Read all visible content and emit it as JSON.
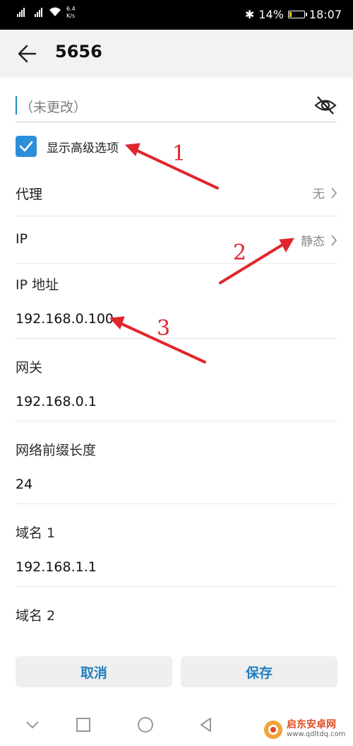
{
  "status_bar": {
    "signal1": "4G",
    "signal2": "x",
    "net_speed_value": "6.4",
    "net_speed_unit": "K/s",
    "battery_percent": "14%",
    "battery_level": 0.14,
    "time": "18:07"
  },
  "header": {
    "title": "5656"
  },
  "password": {
    "placeholder": "（未更改）"
  },
  "advanced": {
    "label": "显示高级选项",
    "checked": true
  },
  "proxy": {
    "label": "代理",
    "value": "无"
  },
  "ip_settings": {
    "label": "IP",
    "value": "静态"
  },
  "ip_address": {
    "label": "IP 地址",
    "value": "192.168.0.100"
  },
  "gateway": {
    "label": "网关",
    "value": "192.168.0.1"
  },
  "prefix": {
    "label": "网络前缀长度",
    "value": "24"
  },
  "dns1": {
    "label": "域名 1",
    "value": "192.168.1.1"
  },
  "dns2": {
    "label": "域名 2"
  },
  "buttons": {
    "cancel": "取消",
    "save": "保存"
  },
  "annotations": [
    "1",
    "2",
    "3"
  ],
  "watermark": {
    "name": "启东安卓网",
    "url": "www.qdltdq.com"
  },
  "colors": {
    "accent": "#1f7fc0",
    "checkbox": "#2e8fd9",
    "annotation": "#e0262d"
  }
}
